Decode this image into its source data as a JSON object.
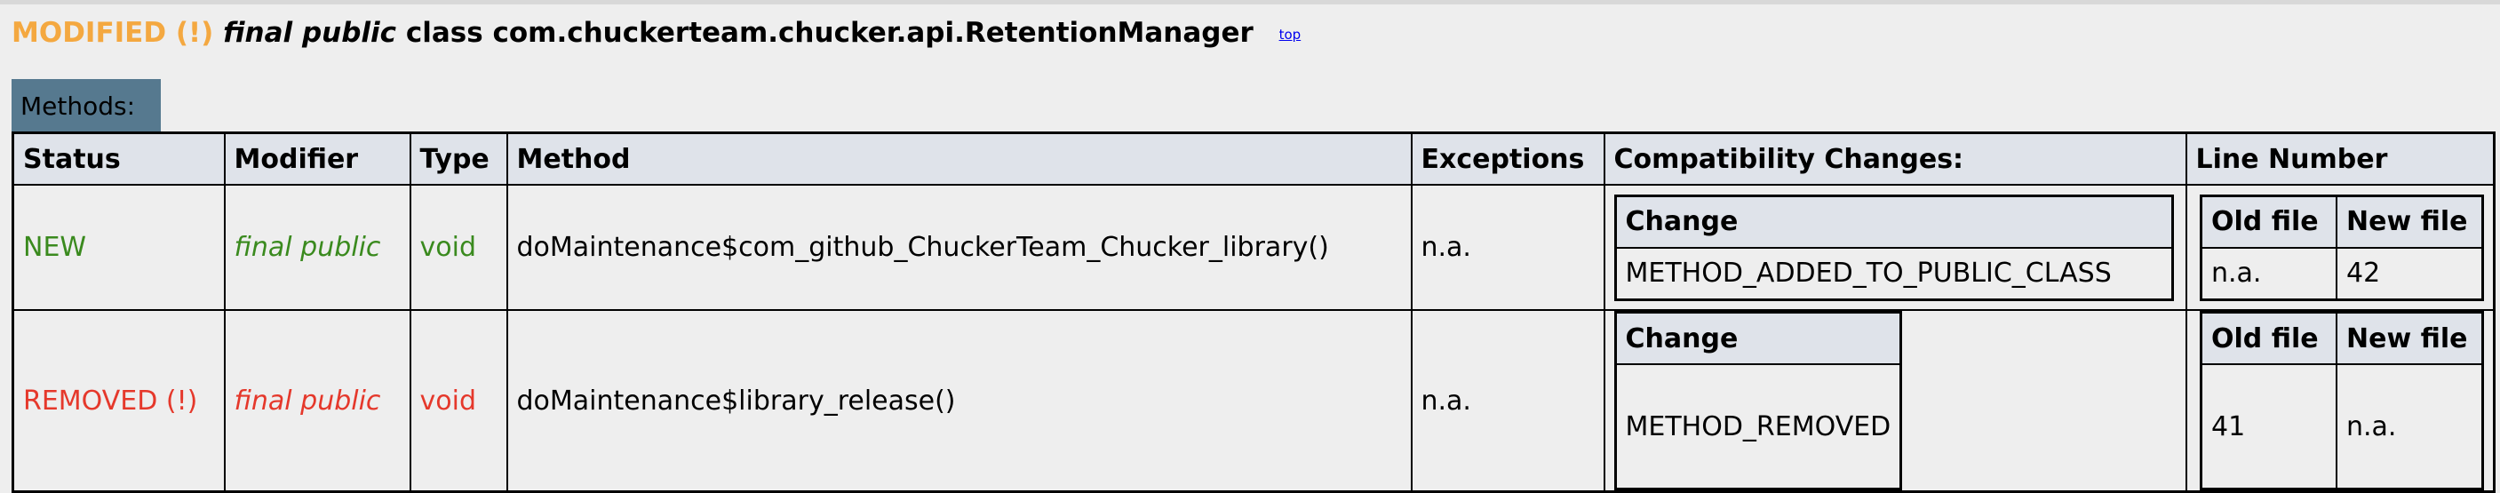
{
  "header": {
    "status": "MODIFIED (!)",
    "modifiers": "final public",
    "kind": "class",
    "class_name": "com.chuckerteam.chucker.api.RetentionManager",
    "top_link": "top"
  },
  "section_label": "Methods:",
  "columns": [
    "Status",
    "Modifier",
    "Type",
    "Method",
    "Exceptions",
    "Compatibility Changes:",
    "Line Number"
  ],
  "inner_headers": {
    "change": "Change",
    "old_file": "Old file",
    "new_file": "New file"
  },
  "rows": [
    {
      "status": "NEW",
      "modifier": "final public",
      "type": "void",
      "method": "doMaintenance$com_github_ChuckerTeam_Chucker_library()",
      "exceptions": "n.a.",
      "change": "METHOD_ADDED_TO_PUBLIC_CLASS",
      "old_line": "n.a.",
      "new_line": "42"
    },
    {
      "status": "REMOVED (!)",
      "modifier": "final public",
      "type": "void",
      "method": "doMaintenance$library_release()",
      "exceptions": "n.a.",
      "change": "METHOD_REMOVED",
      "old_line": "41",
      "new_line": "n.a."
    }
  ],
  "colors": {
    "modified": "#f4a840",
    "new": "#3a8a1e",
    "removed": "#e5382b",
    "header_bg": "#dfe3ea",
    "label_bg": "#56798f"
  }
}
